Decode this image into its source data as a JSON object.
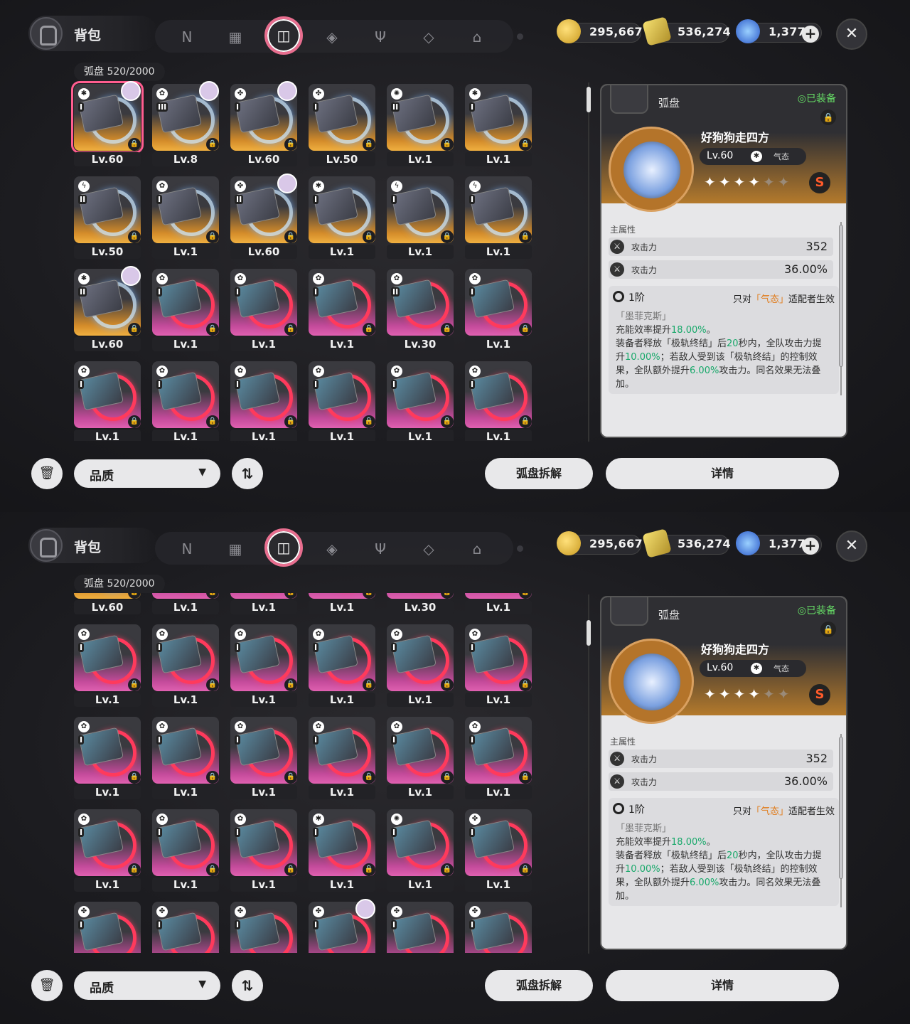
{
  "header": {
    "title": "背包"
  },
  "tabs": [
    {
      "icon": "agent-icon",
      "glyph": "N"
    },
    {
      "icon": "gameboy-icon",
      "glyph": "▦"
    },
    {
      "icon": "disc-icon",
      "glyph": "◫",
      "active": true
    },
    {
      "icon": "cube-icon",
      "glyph": "◈"
    },
    {
      "icon": "cutlery-icon",
      "glyph": "Ψ"
    },
    {
      "icon": "crystal-icon",
      "glyph": "◇"
    },
    {
      "icon": "home-icon",
      "glyph": "⌂"
    }
  ],
  "currency": {
    "coins": "295,667",
    "tickets": "536,274",
    "polychrome": "1,377"
  },
  "inventory": {
    "label": "弧盘  520/2000"
  },
  "filter": {
    "label": "品质"
  },
  "buttons": {
    "dismantle": "弧盘拆解",
    "details": "详情"
  },
  "detail": {
    "type": "弧盘",
    "equipped": "◎已装备",
    "name": "好狗狗走四方",
    "level": "Lv.60",
    "attribute": "气态",
    "stars_filled": 4,
    "stars_total": 6,
    "rank": "S",
    "main_stats_title": "主属性",
    "stats": [
      {
        "name": "攻击力",
        "value": "352"
      },
      {
        "name": "攻击力",
        "value": "36.00%"
      }
    ],
    "tier": "1阶",
    "condition_pre": "只对",
    "condition_hl": "「气态」",
    "condition_post": "适配者生效",
    "effect_name": "「墨菲克斯」",
    "effect_lines": [
      [
        {
          "t": "充能效率提升"
        },
        {
          "t": "18.00%",
          "g": true
        },
        {
          "t": "。"
        }
      ],
      [
        {
          "t": "装备者释放「极轨终结」后"
        },
        {
          "t": "20",
          "g": true
        },
        {
          "t": "秒内，全队攻击力提"
        }
      ],
      [
        {
          "t": "升"
        },
        {
          "t": "10.00%",
          "g": true
        },
        {
          "t": "；若敌人受到该「极轨终结」的控制效"
        }
      ],
      [
        {
          "t": "果，全队额外提升"
        },
        {
          "t": "6.00%",
          "g": true
        },
        {
          "t": "攻击力。同名效果无法叠"
        }
      ],
      [
        {
          "t": "加。"
        }
      ]
    ]
  },
  "grid_top": {
    "cards": [
      {
        "lvl": "Lv.60",
        "tier": "I",
        "color": "orange",
        "attr": "✱",
        "avatar": true,
        "selected": true
      },
      {
        "lvl": "Lv.8",
        "tier": "III",
        "color": "orange",
        "attr": "✿",
        "avatar": true
      },
      {
        "lvl": "Lv.60",
        "tier": "I",
        "color": "orange",
        "attr": "✤",
        "avatar": true
      },
      {
        "lvl": "Lv.50",
        "tier": "I",
        "color": "orange",
        "attr": "✤"
      },
      {
        "lvl": "Lv.1",
        "tier": "II",
        "color": "orange",
        "attr": "✺"
      },
      {
        "lvl": "Lv.1",
        "tier": "I",
        "color": "orange",
        "attr": "✱"
      },
      {
        "lvl": "Lv.50",
        "tier": "II",
        "color": "orange",
        "attr": "ϟ"
      },
      {
        "lvl": "Lv.1",
        "tier": "I",
        "color": "orange",
        "attr": "✿"
      },
      {
        "lvl": "Lv.60",
        "tier": "II",
        "color": "orange",
        "attr": "✤",
        "avatar": true
      },
      {
        "lvl": "Lv.1",
        "tier": "I",
        "color": "orange",
        "attr": "✱"
      },
      {
        "lvl": "Lv.1",
        "tier": "I",
        "color": "orange",
        "attr": "ϟ"
      },
      {
        "lvl": "Lv.1",
        "tier": "I",
        "color": "orange",
        "attr": "ϟ"
      },
      {
        "lvl": "Lv.60",
        "tier": "II",
        "color": "orange",
        "attr": "✱",
        "avatar": true
      },
      {
        "lvl": "Lv.1",
        "tier": "I",
        "color": "pink",
        "attr": "✿"
      },
      {
        "lvl": "Lv.1",
        "tier": "I",
        "color": "pink",
        "attr": "✿"
      },
      {
        "lvl": "Lv.1",
        "tier": "I",
        "color": "pink",
        "attr": "✿"
      },
      {
        "lvl": "Lv.30",
        "tier": "II",
        "color": "pink",
        "attr": "✿"
      },
      {
        "lvl": "Lv.1",
        "tier": "I",
        "color": "pink",
        "attr": "✿"
      },
      {
        "lvl": "Lv.1",
        "tier": "I",
        "color": "pink",
        "attr": "✿"
      },
      {
        "lvl": "Lv.1",
        "tier": "I",
        "color": "pink",
        "attr": "✿"
      },
      {
        "lvl": "Lv.1",
        "tier": "I",
        "color": "pink",
        "attr": "✿"
      },
      {
        "lvl": "Lv.1",
        "tier": "I",
        "color": "pink",
        "attr": "✿"
      },
      {
        "lvl": "Lv.1",
        "tier": "I",
        "color": "pink",
        "attr": "✿"
      },
      {
        "lvl": "Lv.1",
        "tier": "I",
        "color": "pink",
        "attr": "✿"
      }
    ]
  },
  "grid_bottom": {
    "cards": [
      {
        "lvl": "Lv.60",
        "tier": "",
        "color": "orange",
        "attr": ""
      },
      {
        "lvl": "Lv.1",
        "tier": "",
        "color": "pink",
        "attr": ""
      },
      {
        "lvl": "Lv.1",
        "tier": "",
        "color": "pink",
        "attr": ""
      },
      {
        "lvl": "Lv.1",
        "tier": "",
        "color": "pink",
        "attr": ""
      },
      {
        "lvl": "Lv.30",
        "tier": "",
        "color": "pink",
        "attr": ""
      },
      {
        "lvl": "Lv.1",
        "tier": "",
        "color": "pink",
        "attr": ""
      },
      {
        "lvl": "Lv.1",
        "tier": "I",
        "color": "pink",
        "attr": "✿"
      },
      {
        "lvl": "Lv.1",
        "tier": "I",
        "color": "pink",
        "attr": "✿"
      },
      {
        "lvl": "Lv.1",
        "tier": "I",
        "color": "pink",
        "attr": "✿"
      },
      {
        "lvl": "Lv.1",
        "tier": "I",
        "color": "pink",
        "attr": "✿"
      },
      {
        "lvl": "Lv.1",
        "tier": "I",
        "color": "pink",
        "attr": "✿"
      },
      {
        "lvl": "Lv.1",
        "tier": "I",
        "color": "pink",
        "attr": "✿"
      },
      {
        "lvl": "Lv.1",
        "tier": "I",
        "color": "pink",
        "attr": "✿"
      },
      {
        "lvl": "Lv.1",
        "tier": "I",
        "color": "pink",
        "attr": "✿"
      },
      {
        "lvl": "Lv.1",
        "tier": "I",
        "color": "pink",
        "attr": "✿"
      },
      {
        "lvl": "Lv.1",
        "tier": "I",
        "color": "pink",
        "attr": "✿"
      },
      {
        "lvl": "Lv.1",
        "tier": "I",
        "color": "pink",
        "attr": "✿"
      },
      {
        "lvl": "Lv.1",
        "tier": "I",
        "color": "pink",
        "attr": "✿"
      },
      {
        "lvl": "Lv.1",
        "tier": "I",
        "color": "pink",
        "attr": "✿"
      },
      {
        "lvl": "Lv.1",
        "tier": "I",
        "color": "pink",
        "attr": "✿"
      },
      {
        "lvl": "Lv.1",
        "tier": "I",
        "color": "pink",
        "attr": "✿"
      },
      {
        "lvl": "Lv.1",
        "tier": "I",
        "color": "pink",
        "attr": "✱"
      },
      {
        "lvl": "Lv.1",
        "tier": "I",
        "color": "pink",
        "attr": "✺"
      },
      {
        "lvl": "Lv.1",
        "tier": "I",
        "color": "pink",
        "attr": "✤"
      },
      {
        "lvl": "",
        "tier": "I",
        "color": "pink",
        "attr": "✤"
      },
      {
        "lvl": "",
        "tier": "I",
        "color": "pink",
        "attr": "✤"
      },
      {
        "lvl": "",
        "tier": "I",
        "color": "pink",
        "attr": "✤"
      },
      {
        "lvl": "",
        "tier": "I",
        "color": "pink",
        "attr": "✤",
        "avatar": true
      },
      {
        "lvl": "",
        "tier": "I",
        "color": "pink",
        "attr": "✤"
      },
      {
        "lvl": "",
        "tier": "I",
        "color": "pink",
        "attr": "✤"
      }
    ]
  }
}
